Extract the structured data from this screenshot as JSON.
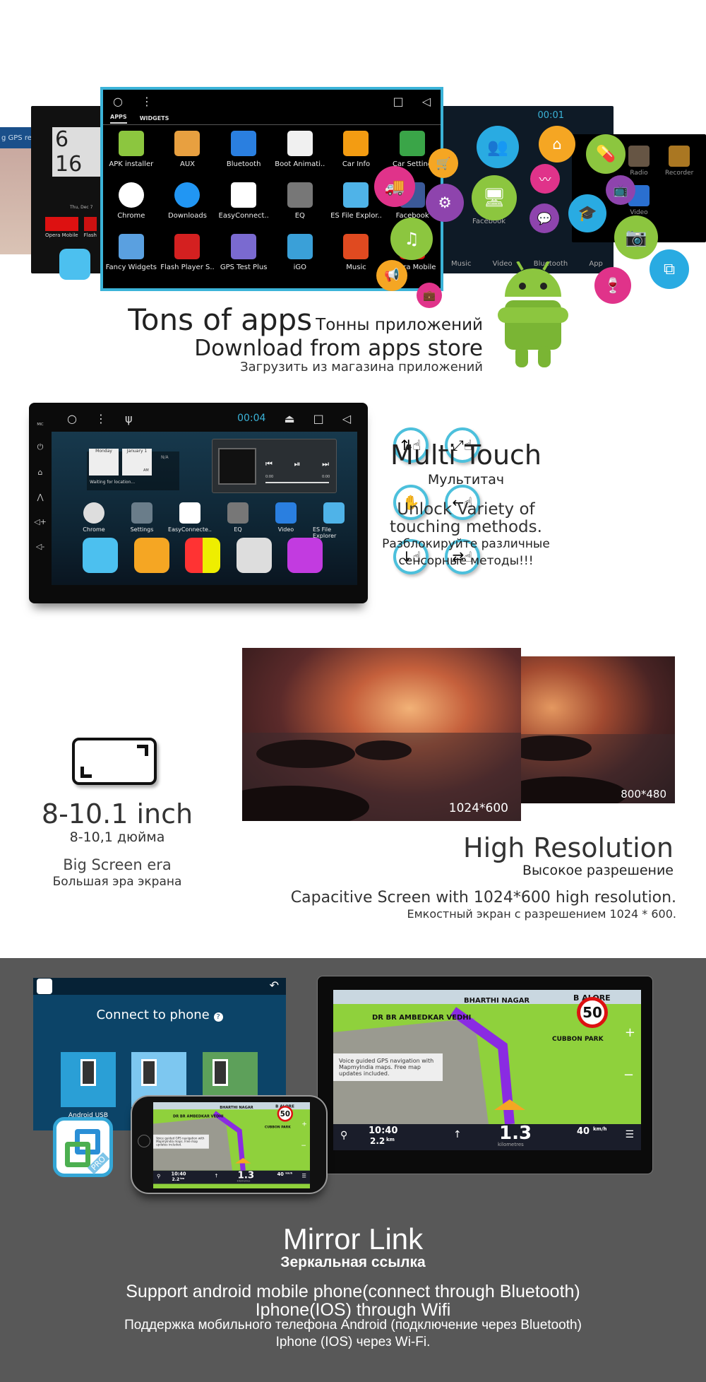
{
  "apps_section": {
    "back_left": {
      "clock": "6 16",
      "date": "Thu, Dec 7",
      "apps": [
        "Opera Mobile",
        "Flash"
      ],
      "gps_text": "g GPS re"
    },
    "back_right": {
      "time": "00:01",
      "apps": [
        "Music",
        "Video",
        "Bluetooth",
        "App",
        "Facebook",
        "Radio",
        "Recorder",
        "Video"
      ]
    },
    "drawer": {
      "tabs": [
        "APPS",
        "WIDGETS"
      ],
      "apps": [
        "APK installer",
        "AUX",
        "Bluetooth",
        "Boot Animati..",
        "Car Info",
        "Car Setting",
        "Chrome",
        "Downloads",
        "EasyConnect..",
        "EQ",
        "ES File Explor..",
        "Facebook",
        "Fancy Widgets",
        "Flash Player S..",
        "GPS Test Plus",
        "iGO",
        "Music",
        "Opera Mobile"
      ]
    },
    "title": "Tons of apps",
    "title_ru": "Тонны приложений",
    "subtitle": "Download from apps store",
    "subtitle_ru": "Загрузить из магазина приложений",
    "bubble_icons": [
      "cart-icon",
      "truck-icon",
      "gear-icon",
      "music-icon",
      "megaphone-icon",
      "briefcase-icon",
      "people-icon",
      "home-icon",
      "pill-icon",
      "monitor-icon",
      "heartbeat-icon",
      "chat-icon",
      "graduation-icon",
      "tv-icon",
      "camera-icon",
      "wine-icon",
      "screen-share-icon"
    ]
  },
  "touch_section": {
    "status_time": "00:04",
    "side_label": "MIC",
    "widget": {
      "day": "Monday",
      "date": "January 1",
      "ampm": "AM",
      "weather": "N/A",
      "location": "Waiting for location..."
    },
    "player": {
      "start": "0:00",
      "end": "0:00"
    },
    "apps": [
      "Chrome",
      "Settings",
      "EasyConnecte..",
      "EQ",
      "Video",
      "ES File Explorer"
    ],
    "gesture_icons": [
      "two-finger-scroll-icon",
      "rotate-icon",
      "multi-finger-icon",
      "swipe-left-icon",
      "scroll-down-icon",
      "swipe-horizontal-icon"
    ],
    "title": "Multi Touch",
    "title_ru": "Мультитач",
    "desc1": "Unlock Variety of",
    "desc2": "touching methods.",
    "desc_ru1": "Разблокируйте различные",
    "desc_ru2": "сенсорные методы!!!"
  },
  "resolution_section": {
    "size": "8-10.1 inch",
    "size_ru": "8-10,1 дюйма",
    "era": "Big Screen era",
    "era_ru": "Большая эра экрана",
    "photo_big_label": "1024*600",
    "photo_small_label": "800*480",
    "title": "High Resolution",
    "title_ru": "Высокое разрешение",
    "desc": "Capacitive Screen with 1024*600 high resolution.",
    "desc_ru": "Емкостный экран с разрешением 1024 * 600."
  },
  "mirror_section": {
    "connect_title": "Connect to phone",
    "tile_label": "Android USB",
    "pro_badge": "PRO",
    "map": {
      "places": [
        "BHARTHI NAGAR",
        "DR BR AMBEDKAR VEDHI",
        "B   ALORE",
        "CUBBON PARK"
      ],
      "speed_limit": "50",
      "tip": "Voice guided GPS navigation with MapmyIndia maps. Free map updates included.",
      "time": "10:40",
      "dist": "2.2",
      "dist_unit": "km",
      "next": "1.3",
      "next_unit": "kilometres",
      "speed": "40",
      "speed_unit": "km/h"
    },
    "title": "Mirror Link",
    "title_ru": "Зеркальная ссылка",
    "line1": "Support android mobile phone(connect through Bluetooth)",
    "line2": "Iphone(IOS) through Wifi",
    "line_ru1": "Поддержка мобильного телефона Android (подключение через Bluetooth)",
    "line_ru2": "Iphone (IOS) через Wi-Fi."
  },
  "colors": {
    "accent": "#3bb3d8",
    "dark_bg": "#585858",
    "touch_ring": "#4cc0dc"
  }
}
